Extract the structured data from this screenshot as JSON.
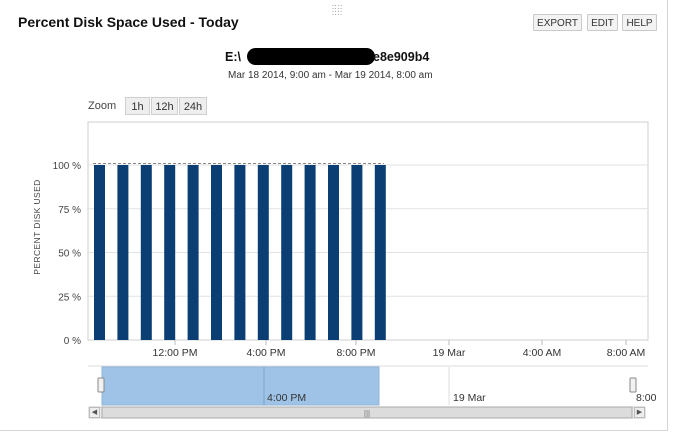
{
  "widget": {
    "title": "Percent Disk Space Used - Today",
    "buttons": {
      "export": "EXPORT",
      "edit": "EDIT",
      "help": "HELP"
    },
    "host_prefix": "E:\\",
    "host_suffix": "e8e909b4",
    "date_range": "Mar 18 2014, 9:00 am - Mar 19 2014, 8:00 am"
  },
  "zoom": {
    "label": "Zoom",
    "options": [
      "1h",
      "12h",
      "24h"
    ]
  },
  "chart_data": {
    "type": "bar",
    "ylabel": "PERCENT DISK USED",
    "ylim": [
      0,
      100
    ],
    "yticks": [
      "0 %",
      "25 %",
      "50 %",
      "75 %",
      "100 %"
    ],
    "ytick_values": [
      0,
      25,
      50,
      75,
      100
    ],
    "xticks": [
      "12:00 PM",
      "4:00 PM",
      "8:00 PM",
      "19 Mar",
      "4:00 AM",
      "8:00 AM"
    ],
    "categories": [
      "9:00 AM",
      "10:00 AM",
      "11:00 AM",
      "12:00 PM",
      "1:00 PM",
      "2:00 PM",
      "3:00 PM",
      "4:00 PM",
      "5:00 PM",
      "6:00 PM",
      "7:00 PM",
      "8:00 PM",
      "9:00 PM"
    ],
    "values": [
      100,
      100,
      100,
      100,
      100,
      100,
      100,
      100,
      100,
      100,
      100,
      100,
      100
    ],
    "threshold": 100,
    "bar_color": "#0b3e73",
    "grid": true
  },
  "navigator": {
    "labels": [
      "4:00 PM",
      "19 Mar",
      "8:00"
    ],
    "selection_color": "#9ec3e6"
  }
}
